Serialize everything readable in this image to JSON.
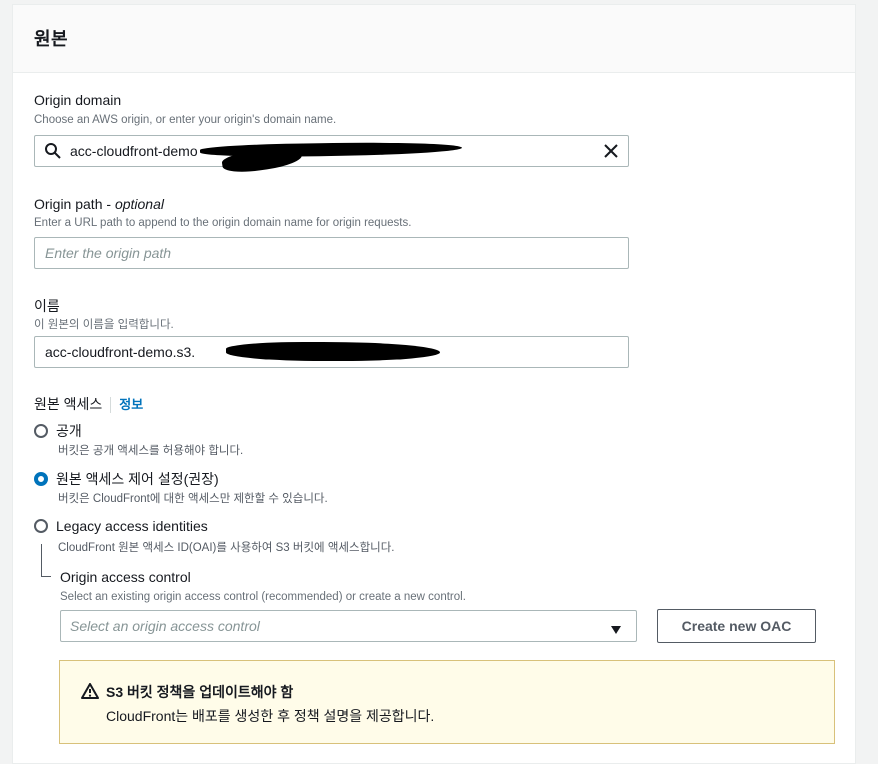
{
  "panel": {
    "title": "원본"
  },
  "origin_domain": {
    "label": "Origin domain",
    "description": "Choose an AWS origin, or enter your origin's domain name.",
    "value": "acc-cloudfront-demo"
  },
  "origin_path": {
    "label": "Origin path - ",
    "label_optional": "optional",
    "description": "Enter a URL path to append to the origin domain name for origin requests.",
    "placeholder": "Enter the origin path"
  },
  "name": {
    "label": "이름",
    "description": "이 원본의 이름을 입력합니다.",
    "value": "acc-cloudfront-demo.s3."
  },
  "origin_access": {
    "label": "원본 액세스",
    "info_link": "정보",
    "options": [
      {
        "label": "공개",
        "description": "버킷은 공개 액세스를 허용해야 합니다.",
        "checked": false
      },
      {
        "label": "원본 액세스 제어 설정(권장)",
        "description": "버킷은 CloudFront에 대한 액세스만 제한할 수 있습니다.",
        "checked": true
      },
      {
        "label": "Legacy access identities",
        "description": "CloudFront 원본 액세스 ID(OAI)를 사용하여 S3 버킷에 액세스합니다.",
        "checked": false
      }
    ]
  },
  "oac": {
    "label": "Origin access control",
    "description": "Select an existing origin access control (recommended) or create a new control.",
    "placeholder": "Select an origin access control",
    "create_button": "Create new OAC"
  },
  "alert": {
    "title": "S3 버킷 정책을 업데이트해야 함",
    "body": "CloudFront는 배포를 생성한 후 정책 설명을 제공합니다."
  },
  "icons": {
    "search": "search-icon",
    "clear": "close-icon",
    "dropdown": "caret-down-icon",
    "warning": "warning-icon"
  },
  "colors": {
    "accent": "#0073bb",
    "alert_bg": "#fffce9",
    "alert_border": "#d8c17a"
  }
}
